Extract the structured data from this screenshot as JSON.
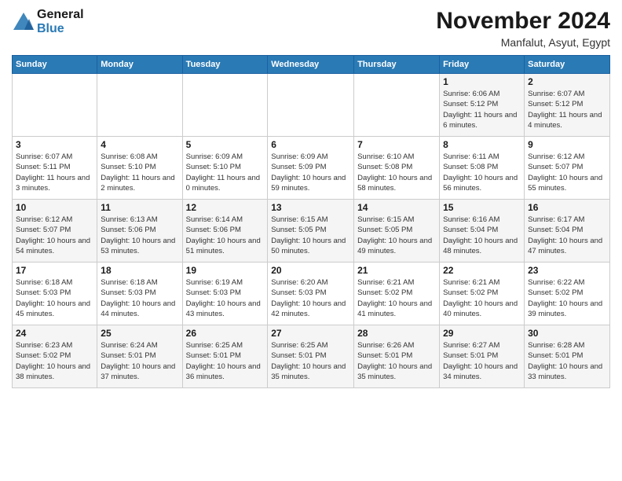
{
  "header": {
    "logo_line1": "General",
    "logo_line2": "Blue",
    "month_title": "November 2024",
    "location": "Manfalut, Asyut, Egypt"
  },
  "calendar": {
    "days_of_week": [
      "Sunday",
      "Monday",
      "Tuesday",
      "Wednesday",
      "Thursday",
      "Friday",
      "Saturday"
    ],
    "weeks": [
      [
        {
          "day": "",
          "info": ""
        },
        {
          "day": "",
          "info": ""
        },
        {
          "day": "",
          "info": ""
        },
        {
          "day": "",
          "info": ""
        },
        {
          "day": "",
          "info": ""
        },
        {
          "day": "1",
          "info": "Sunrise: 6:06 AM\nSunset: 5:12 PM\nDaylight: 11 hours and 6 minutes."
        },
        {
          "day": "2",
          "info": "Sunrise: 6:07 AM\nSunset: 5:12 PM\nDaylight: 11 hours and 4 minutes."
        }
      ],
      [
        {
          "day": "3",
          "info": "Sunrise: 6:07 AM\nSunset: 5:11 PM\nDaylight: 11 hours and 3 minutes."
        },
        {
          "day": "4",
          "info": "Sunrise: 6:08 AM\nSunset: 5:10 PM\nDaylight: 11 hours and 2 minutes."
        },
        {
          "day": "5",
          "info": "Sunrise: 6:09 AM\nSunset: 5:10 PM\nDaylight: 11 hours and 0 minutes."
        },
        {
          "day": "6",
          "info": "Sunrise: 6:09 AM\nSunset: 5:09 PM\nDaylight: 10 hours and 59 minutes."
        },
        {
          "day": "7",
          "info": "Sunrise: 6:10 AM\nSunset: 5:08 PM\nDaylight: 10 hours and 58 minutes."
        },
        {
          "day": "8",
          "info": "Sunrise: 6:11 AM\nSunset: 5:08 PM\nDaylight: 10 hours and 56 minutes."
        },
        {
          "day": "9",
          "info": "Sunrise: 6:12 AM\nSunset: 5:07 PM\nDaylight: 10 hours and 55 minutes."
        }
      ],
      [
        {
          "day": "10",
          "info": "Sunrise: 6:12 AM\nSunset: 5:07 PM\nDaylight: 10 hours and 54 minutes."
        },
        {
          "day": "11",
          "info": "Sunrise: 6:13 AM\nSunset: 5:06 PM\nDaylight: 10 hours and 53 minutes."
        },
        {
          "day": "12",
          "info": "Sunrise: 6:14 AM\nSunset: 5:06 PM\nDaylight: 10 hours and 51 minutes."
        },
        {
          "day": "13",
          "info": "Sunrise: 6:15 AM\nSunset: 5:05 PM\nDaylight: 10 hours and 50 minutes."
        },
        {
          "day": "14",
          "info": "Sunrise: 6:15 AM\nSunset: 5:05 PM\nDaylight: 10 hours and 49 minutes."
        },
        {
          "day": "15",
          "info": "Sunrise: 6:16 AM\nSunset: 5:04 PM\nDaylight: 10 hours and 48 minutes."
        },
        {
          "day": "16",
          "info": "Sunrise: 6:17 AM\nSunset: 5:04 PM\nDaylight: 10 hours and 47 minutes."
        }
      ],
      [
        {
          "day": "17",
          "info": "Sunrise: 6:18 AM\nSunset: 5:03 PM\nDaylight: 10 hours and 45 minutes."
        },
        {
          "day": "18",
          "info": "Sunrise: 6:18 AM\nSunset: 5:03 PM\nDaylight: 10 hours and 44 minutes."
        },
        {
          "day": "19",
          "info": "Sunrise: 6:19 AM\nSunset: 5:03 PM\nDaylight: 10 hours and 43 minutes."
        },
        {
          "day": "20",
          "info": "Sunrise: 6:20 AM\nSunset: 5:03 PM\nDaylight: 10 hours and 42 minutes."
        },
        {
          "day": "21",
          "info": "Sunrise: 6:21 AM\nSunset: 5:02 PM\nDaylight: 10 hours and 41 minutes."
        },
        {
          "day": "22",
          "info": "Sunrise: 6:21 AM\nSunset: 5:02 PM\nDaylight: 10 hours and 40 minutes."
        },
        {
          "day": "23",
          "info": "Sunrise: 6:22 AM\nSunset: 5:02 PM\nDaylight: 10 hours and 39 minutes."
        }
      ],
      [
        {
          "day": "24",
          "info": "Sunrise: 6:23 AM\nSunset: 5:02 PM\nDaylight: 10 hours and 38 minutes."
        },
        {
          "day": "25",
          "info": "Sunrise: 6:24 AM\nSunset: 5:01 PM\nDaylight: 10 hours and 37 minutes."
        },
        {
          "day": "26",
          "info": "Sunrise: 6:25 AM\nSunset: 5:01 PM\nDaylight: 10 hours and 36 minutes."
        },
        {
          "day": "27",
          "info": "Sunrise: 6:25 AM\nSunset: 5:01 PM\nDaylight: 10 hours and 35 minutes."
        },
        {
          "day": "28",
          "info": "Sunrise: 6:26 AM\nSunset: 5:01 PM\nDaylight: 10 hours and 35 minutes."
        },
        {
          "day": "29",
          "info": "Sunrise: 6:27 AM\nSunset: 5:01 PM\nDaylight: 10 hours and 34 minutes."
        },
        {
          "day": "30",
          "info": "Sunrise: 6:28 AM\nSunset: 5:01 PM\nDaylight: 10 hours and 33 minutes."
        }
      ]
    ]
  }
}
